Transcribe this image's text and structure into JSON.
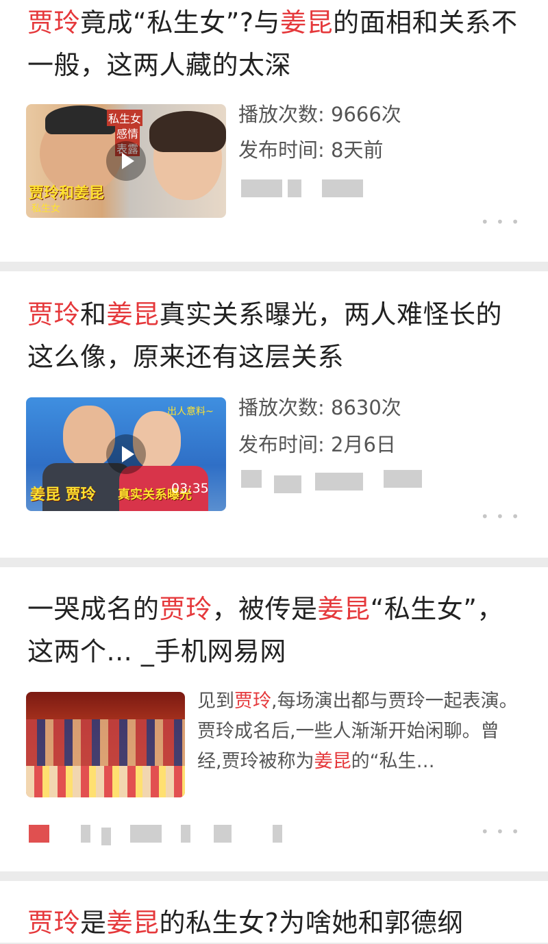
{
  "colors": {
    "highlight": "#e5383b",
    "text": "#222222",
    "meta": "#555555",
    "divider": "#ebebeb"
  },
  "results": [
    {
      "title": [
        {
          "t": "贾玲",
          "hl": true
        },
        {
          "t": "竟成“私生女”?与",
          "hl": false
        },
        {
          "t": "姜昆",
          "hl": true
        },
        {
          "t": "的面相和关系不一般，这两人藏的太深",
          "hl": false
        }
      ],
      "views": "播放次数: 9666次",
      "published": "发布时间: 8天前",
      "thumb_text": {
        "overlay_top": "私生女",
        "overlay_mid": "感情",
        "overlay_bot": "表露",
        "caption": "贾玲和姜昆",
        "sub": "私生女"
      },
      "more_icon": "more-dots-icon"
    },
    {
      "title": [
        {
          "t": "贾玲",
          "hl": true
        },
        {
          "t": "和",
          "hl": false
        },
        {
          "t": "姜昆",
          "hl": true
        },
        {
          "t": "真实关系曝光，两人难怪长的这么像，原来还有这层关系",
          "hl": false
        }
      ],
      "views": "播放次数: 8630次",
      "published": "发布时间: 2月6日",
      "duration": "03:35",
      "thumb_text": {
        "corner": "出人意料~",
        "caption": "姜昆 贾玲",
        "caption2": "真实关系曝光"
      },
      "more_icon": "more-dots-icon"
    },
    {
      "title": [
        {
          "t": "一哭成名的",
          "hl": false
        },
        {
          "t": "贾玲",
          "hl": true
        },
        {
          "t": "，被传是",
          "hl": false
        },
        {
          "t": "姜昆",
          "hl": true
        },
        {
          "t": "“私生女”，这两个... _手机网易网",
          "hl": false
        }
      ],
      "desc": [
        {
          "t": "见到",
          "hl": false
        },
        {
          "t": "贾玲",
          "hl": true
        },
        {
          "t": ",每场演出都与贾玲一起表演。贾玲成名后,一些人渐渐开始闲聊。曾经,贾玲被称为",
          "hl": false
        },
        {
          "t": "姜昆",
          "hl": true
        },
        {
          "t": "的“私生…",
          "hl": false
        }
      ],
      "more_icon": "more-dots-icon"
    },
    {
      "title": [
        {
          "t": "贾玲",
          "hl": true
        },
        {
          "t": "是",
          "hl": false
        },
        {
          "t": "姜昆",
          "hl": true
        },
        {
          "t": "的私生女?为啥她和郭德纲",
          "hl": false
        }
      ]
    }
  ]
}
